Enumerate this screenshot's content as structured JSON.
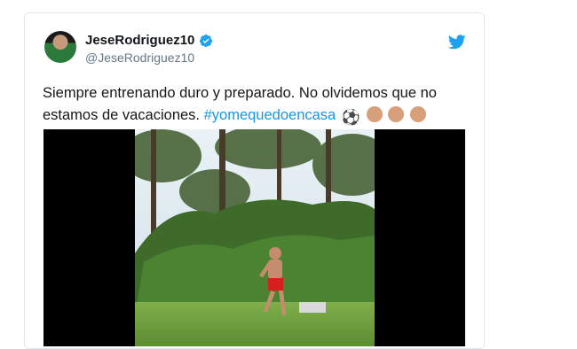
{
  "tweet": {
    "display_name": "JeseRodriguez10",
    "handle": "@JeseRodriguez10",
    "text_line1": "Siempre entrenando duro y preparado. No olvidemos que no",
    "text_line2_plain": "estamos de vacaciones. ",
    "hashtag": "#yomequedoencasa",
    "emoji_ball": "⚽"
  },
  "icons": {
    "verified": "verified-badge-icon",
    "brand": "twitter-bird-icon"
  },
  "colors": {
    "hashtag": "#1b95e0",
    "verified": "#1da1f2",
    "handle": "#657786",
    "text": "#14171a"
  }
}
